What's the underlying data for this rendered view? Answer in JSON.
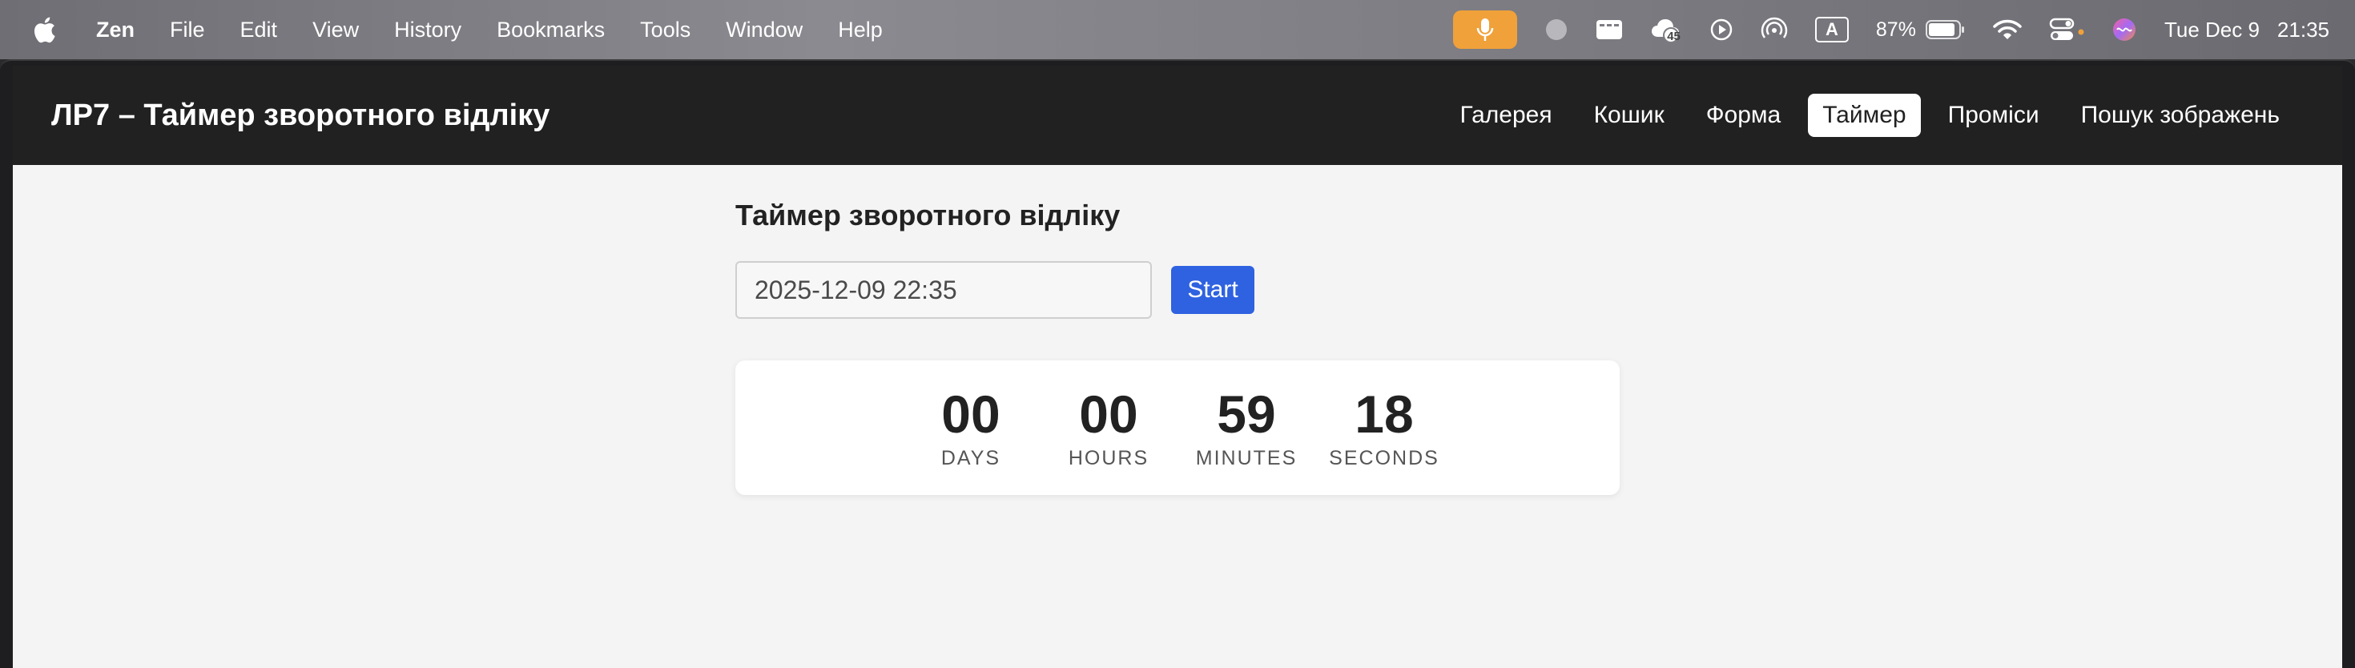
{
  "menubar": {
    "app_name": "Zen",
    "items": [
      "File",
      "Edit",
      "View",
      "History",
      "Bookmarks",
      "Tools",
      "Window",
      "Help"
    ],
    "status": {
      "cloud_badge": "45",
      "input_source": "A",
      "battery_percent": "87%",
      "date": "Tue Dec 9",
      "time": "21:35"
    },
    "icons": [
      "apple-icon",
      "microphone-icon",
      "record-icon",
      "display-icon",
      "cloud-icon",
      "play-icon",
      "airdrop-icon",
      "input-source-icon",
      "battery-icon",
      "wifi-icon",
      "control-center-icon",
      "siri-icon"
    ],
    "colors": {
      "mic_accent": "#f0a13a"
    }
  },
  "navbar": {
    "brand": "ЛР7 – Таймер зворотного відліку",
    "links": [
      "Галерея",
      "Кошик",
      "Форма",
      "Таймер",
      "Проміси",
      "Пошук зображень"
    ],
    "active_link": "Таймер"
  },
  "main": {
    "title": "Таймер зворотного відліку",
    "datetime_value": "2025-12-09 22:35",
    "start_label": "Start",
    "countdown": {
      "days": {
        "value": "00",
        "label": "DAYS"
      },
      "hours": {
        "value": "00",
        "label": "HOURS"
      },
      "minutes": {
        "value": "59",
        "label": "MINUTES"
      },
      "seconds": {
        "value": "18",
        "label": "SECONDS"
      }
    },
    "colors": {
      "accent": "#2f62e0",
      "page_bg": "#f4f4f4",
      "navbar_bg": "#212121"
    }
  }
}
